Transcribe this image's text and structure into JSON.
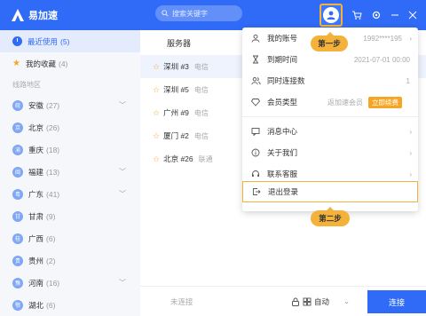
{
  "app": {
    "name": "易加速"
  },
  "search": {
    "placeholder": "搜索关键字"
  },
  "sidebar": {
    "recent": {
      "label": "最近使用",
      "count": "(5)"
    },
    "favorites": {
      "label": "我的收藏",
      "count": "(4)"
    },
    "section_title": "线路地区",
    "regions": [
      {
        "abbr": "皖",
        "name": "安徽",
        "count": "(27)"
      },
      {
        "abbr": "京",
        "name": "北京",
        "count": "(26)"
      },
      {
        "abbr": "渝",
        "name": "重庆",
        "count": "(18)"
      },
      {
        "abbr": "闽",
        "name": "福建",
        "count": "(13)"
      },
      {
        "abbr": "粤",
        "name": "广东",
        "count": "(41)"
      },
      {
        "abbr": "甘",
        "name": "甘肃",
        "count": "(9)"
      },
      {
        "abbr": "桂",
        "name": "广西",
        "count": "(6)"
      },
      {
        "abbr": "贵",
        "name": "贵州",
        "count": "(2)"
      },
      {
        "abbr": "豫",
        "name": "河南",
        "count": "(16)"
      },
      {
        "abbr": "鄂",
        "name": "湖北",
        "count": "(6)"
      }
    ]
  },
  "main": {
    "column_header": "服务器",
    "servers": [
      {
        "name": "深圳 #3",
        "isp": "电信"
      },
      {
        "name": "深圳 #5",
        "isp": "电信"
      },
      {
        "name": "广州 #9",
        "isp": "电信"
      },
      {
        "name": "厦门 #2",
        "isp": "电信"
      },
      {
        "name": "北京 #26",
        "isp": "联通"
      }
    ]
  },
  "bottom": {
    "status": "未连接",
    "mode_label": "自动",
    "connect_label": "连接"
  },
  "menu": {
    "account": {
      "label": "我的账号",
      "value": "1992****195"
    },
    "expiry": {
      "label": "到期时间",
      "value": "2021-07-01 00:00"
    },
    "concurrent": {
      "label": "同时连接数",
      "value": "1"
    },
    "member": {
      "label": "会员类型",
      "value": "返加速会员",
      "badge": "立即续费"
    },
    "messages": {
      "label": "消息中心"
    },
    "about": {
      "label": "关于我们"
    },
    "support": {
      "label": "联系客服"
    },
    "logout": {
      "label": "退出登录"
    }
  },
  "callouts": {
    "step1": "第一步",
    "step2": "第二步"
  },
  "colors": {
    "primary": "#2f6bf6",
    "accent": "#f4b23a",
    "star": "#f4a724"
  }
}
